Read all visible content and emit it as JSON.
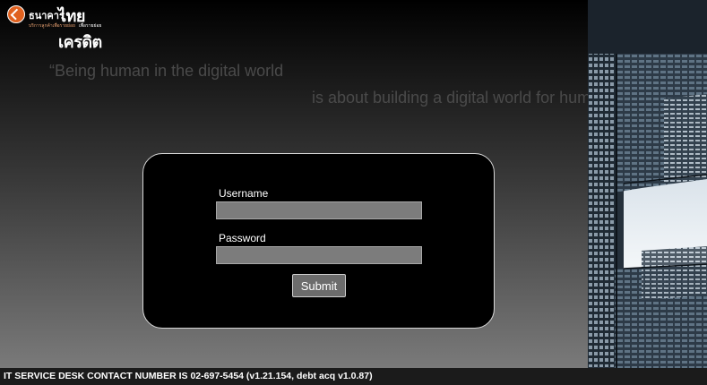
{
  "logo": {
    "brand_main": "ธนาคาร",
    "brand_big": "ไทยเครดิต",
    "sub": "บริการลูกค้าเพื่อรายย่อย",
    "tag": "เพื่อรายย่อย"
  },
  "tagline": {
    "line1": "“Being human in the digital world",
    "line2": "is about building a digital world for humans”"
  },
  "login": {
    "username_label": "Username",
    "username_value": "",
    "password_label": "Password",
    "password_value": "",
    "submit_label": "Submit"
  },
  "footer": {
    "text": "IT SERVICE DESK CONTACT NUMBER IS 02-697-5454 (v1.21.154, debt acq v1.0.87)"
  },
  "colors": {
    "brand_orange": "#e0611f",
    "card_bg": "#000000",
    "input_bg": "#7c7c7c"
  }
}
